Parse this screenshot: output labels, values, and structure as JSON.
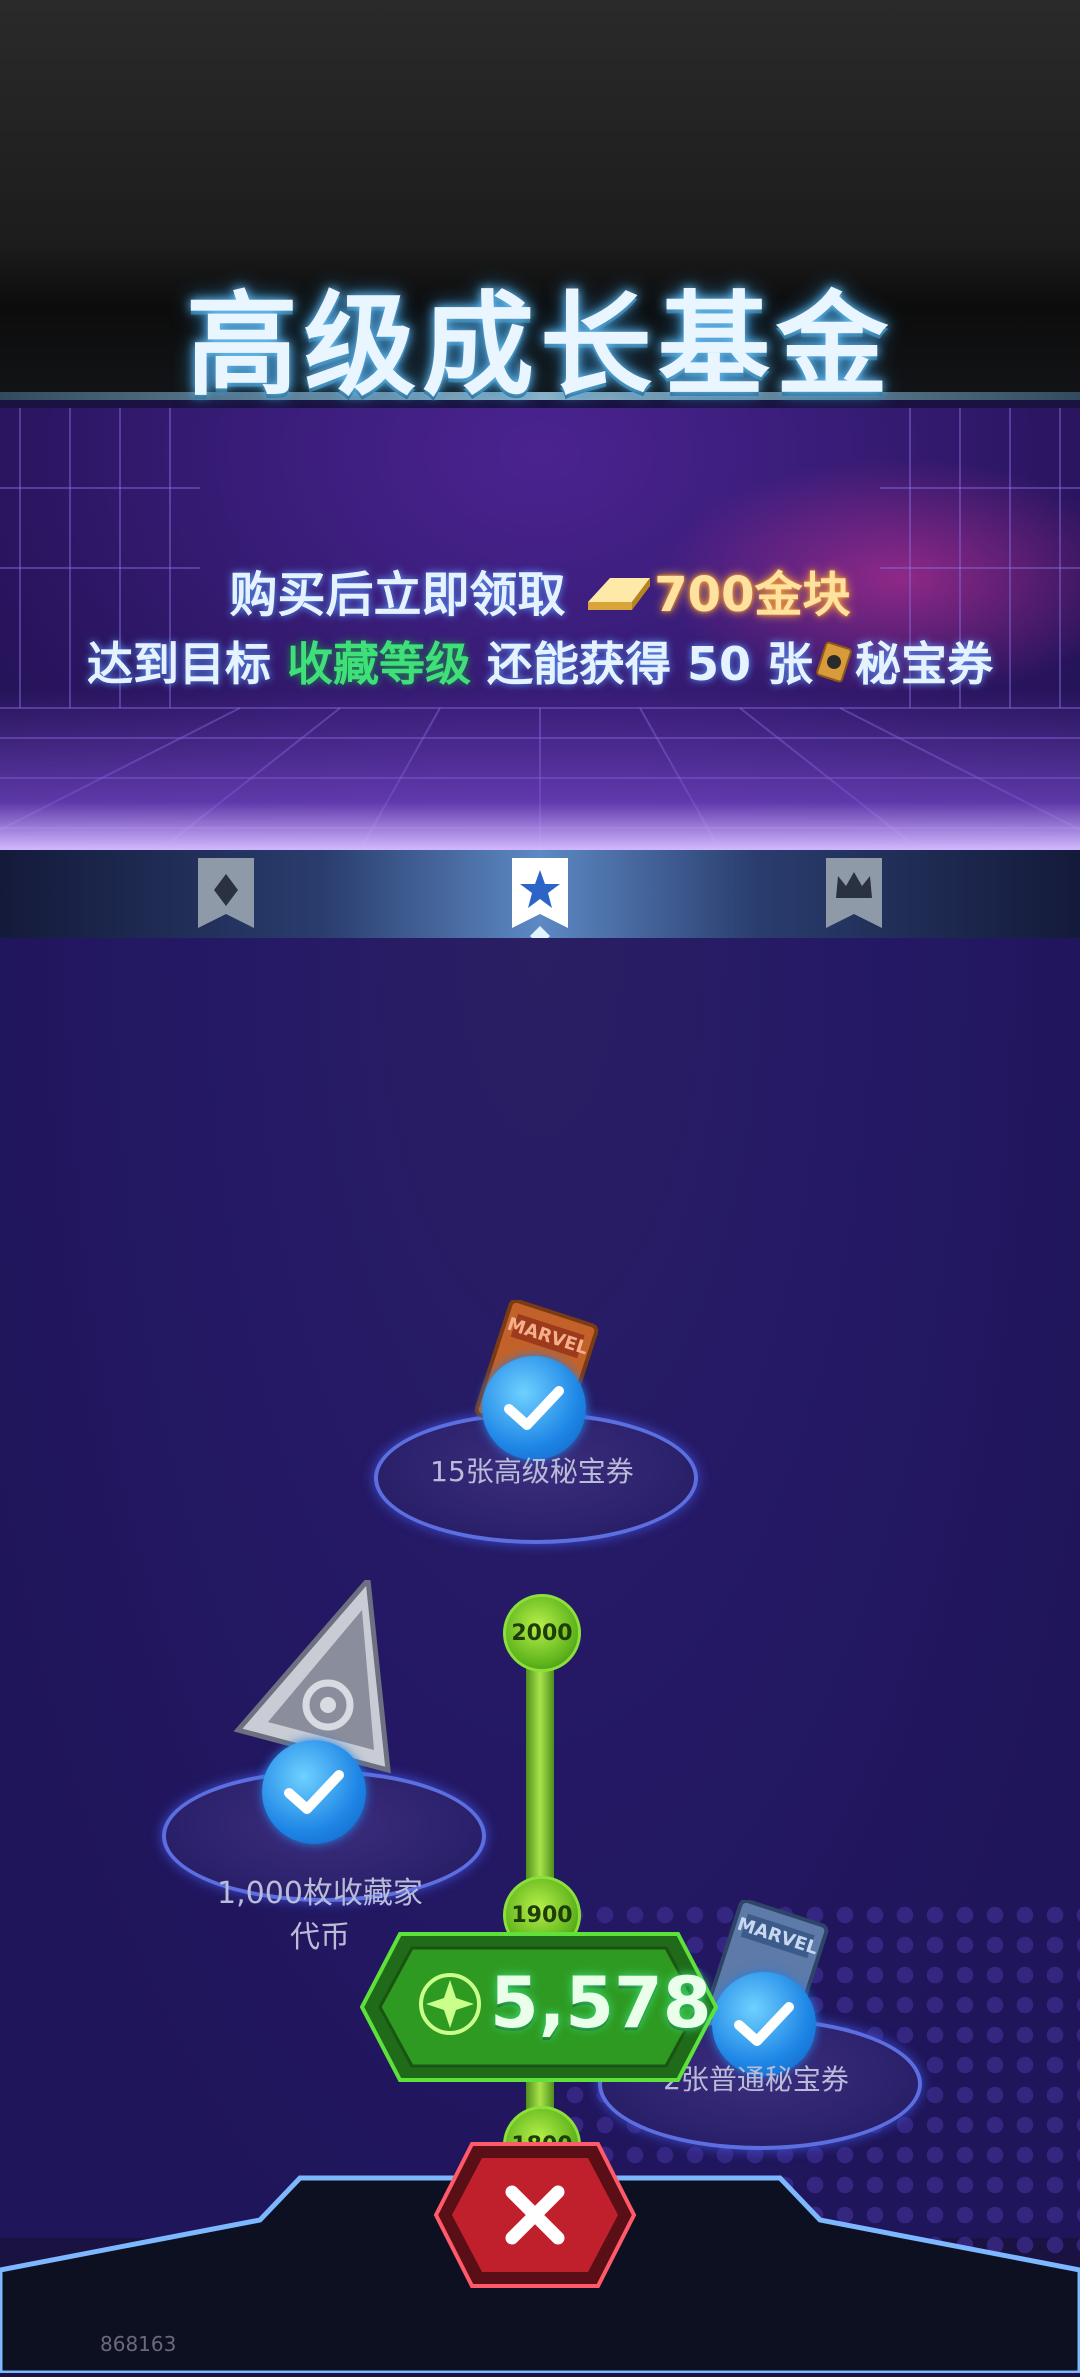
{
  "header": {
    "title": "高级成长基金"
  },
  "banner": {
    "line1_prefix": "购买后立即领取",
    "line1_reward": "700金块",
    "line2_prefix": "达到目标",
    "line2_highlight": "收藏等级",
    "line2_suffix_a": "还能获得 50 张",
    "line2_suffix_b": "秘宝券"
  },
  "tabs": [
    {
      "icon": "diamond-icon",
      "active": false
    },
    {
      "icon": "star-icon",
      "active": true
    },
    {
      "icon": "crown-icon",
      "active": false
    }
  ],
  "rewards": [
    {
      "label": "15张高级秘宝券",
      "claimed": true
    },
    {
      "label_line1": "1,000枚收藏家",
      "label_line2": "代币",
      "claimed": true
    },
    {
      "label": "2张普通秘宝券",
      "claimed": true
    }
  ],
  "levels": [
    "2000",
    "1900",
    "1800"
  ],
  "counter": {
    "value": "5,578"
  },
  "footer": {
    "id": "868163"
  },
  "colors": {
    "accent_green": "#3fe07a",
    "gold": "#ffe2a0",
    "check_blue": "#1e86e6",
    "close_red": "#c0202c"
  }
}
